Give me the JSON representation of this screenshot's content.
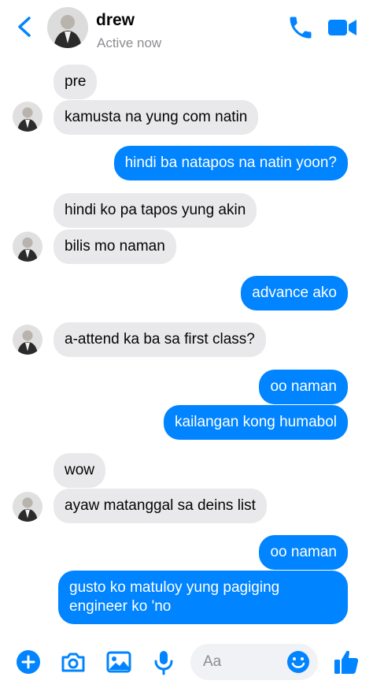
{
  "contact": {
    "name": "drew",
    "status": "Active now"
  },
  "messages": [
    {
      "from": "them",
      "text": "pre"
    },
    {
      "from": "them",
      "text": "kamusta na yung com natin"
    },
    {
      "from": "me",
      "text": "hindi ba natapos na natin yoon?"
    },
    {
      "from": "them",
      "text": "hindi ko pa tapos yung akin"
    },
    {
      "from": "them",
      "text": "bilis mo naman"
    },
    {
      "from": "me",
      "text": "advance ako"
    },
    {
      "from": "them",
      "text": "a-attend ka ba sa first class?"
    },
    {
      "from": "me",
      "text": "oo naman"
    },
    {
      "from": "me",
      "text": "kailangan kong humabol"
    },
    {
      "from": "them",
      "text": "wow"
    },
    {
      "from": "them",
      "text": "ayaw matanggal sa deins list"
    },
    {
      "from": "me",
      "text": "oo naman"
    },
    {
      "from": "me",
      "text": "gusto ko matuloy yung pagiging engineer ko 'no"
    }
  ],
  "composer": {
    "placeholder": "Aa"
  },
  "colors": {
    "accent": "#0084ff",
    "incoming_bubble": "#e9e9eb",
    "outgoing_text": "#ffffff"
  },
  "icons": [
    "back-icon",
    "phone-icon",
    "video-camera-icon",
    "plus-icon",
    "camera-icon",
    "image-icon",
    "microphone-icon",
    "emoji-icon",
    "thumbs-up-icon"
  ]
}
